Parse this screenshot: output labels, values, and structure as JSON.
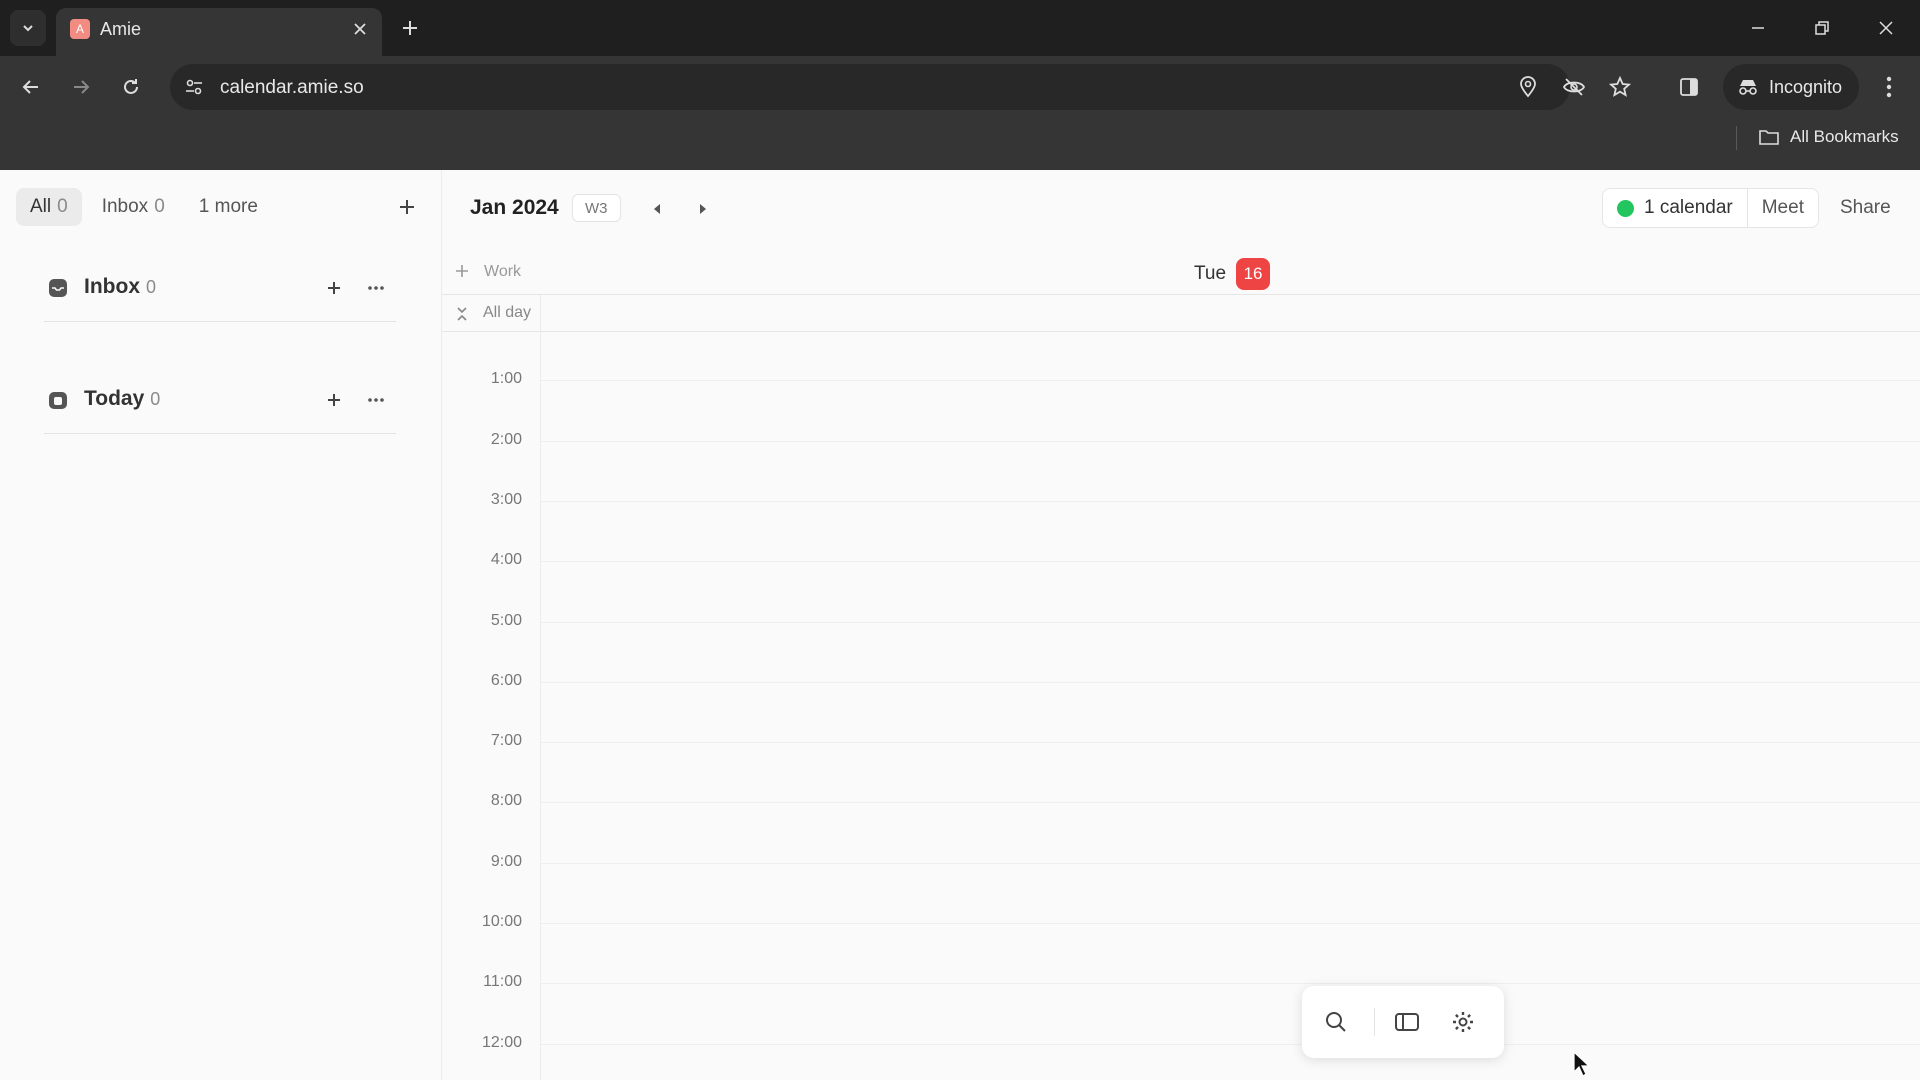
{
  "browser": {
    "tab_title": "Amie",
    "tab_favicon_letter": "A",
    "url": "calendar.amie.so",
    "incognito_label": "Incognito",
    "bookmarks_label": "All Bookmarks"
  },
  "sidebar": {
    "filters": [
      {
        "label": "All",
        "count": "0"
      },
      {
        "label": "Inbox",
        "count": "0"
      },
      {
        "label": "1 more",
        "count": ""
      }
    ],
    "sections": [
      {
        "label": "Inbox",
        "count": "0",
        "icon": "inbox-icon"
      },
      {
        "label": "Today",
        "count": "0",
        "icon": "calendar-today-icon"
      }
    ]
  },
  "calendar": {
    "month_label": "Jan 2024",
    "week_label": "W3",
    "calendars_label": "1 calendar",
    "calendar_color": "#22c55e",
    "meet_label": "Meet",
    "share_label": "Share",
    "work_label": "Work",
    "allday_label": "All day",
    "day_name": "Tue",
    "day_number": "16",
    "today_color": "#ef4444",
    "hours": [
      "1:00",
      "2:00",
      "3:00",
      "4:00",
      "5:00",
      "6:00",
      "7:00",
      "8:00",
      "9:00",
      "10:00",
      "11:00",
      "12:00"
    ]
  }
}
